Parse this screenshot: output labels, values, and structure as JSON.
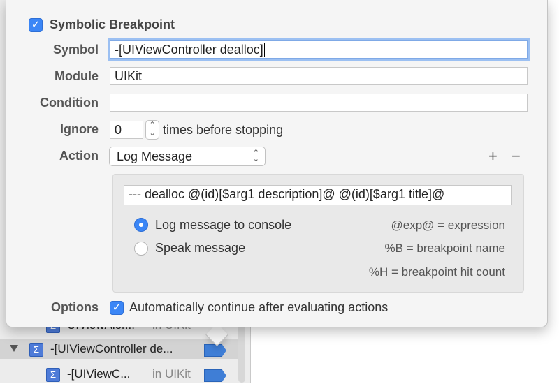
{
  "navigator": {
    "rows": [
      {
        "name": "UIViewAler...",
        "module": "in UIKit"
      },
      {
        "name": "-[UIViewController de...",
        "module": ""
      },
      {
        "name": "-[UIViewC...",
        "module": "in UIKit"
      }
    ]
  },
  "popover": {
    "title": "Symbolic Breakpoint",
    "enabled": true,
    "symbol_label": "Symbol",
    "symbol_value": "-[UIViewController dealloc]",
    "module_label": "Module",
    "module_value": "UIKit",
    "condition_label": "Condition",
    "condition_value": "",
    "ignore_label": "Ignore",
    "ignore_value": "0",
    "ignore_suffix": "times before stopping",
    "action_label": "Action",
    "action_value": "Log Message",
    "add_label": "+",
    "remove_label": "−",
    "action": {
      "message": "--- dealloc @(id)[$arg1 description]@ @(id)[$arg1 title]@",
      "radio_console": "Log message to console",
      "radio_speak": "Speak message",
      "selected": "console",
      "hint_exp": "@exp@ = expression",
      "hint_b": "%B = breakpoint name",
      "hint_h": "%H = breakpoint hit count"
    },
    "options_label": "Options",
    "auto_continue_label": "Automatically continue after evaluating actions",
    "auto_continue": true
  },
  "colors": {
    "accent": "#3b86f6",
    "breakpoint": "#3f7ed6"
  }
}
